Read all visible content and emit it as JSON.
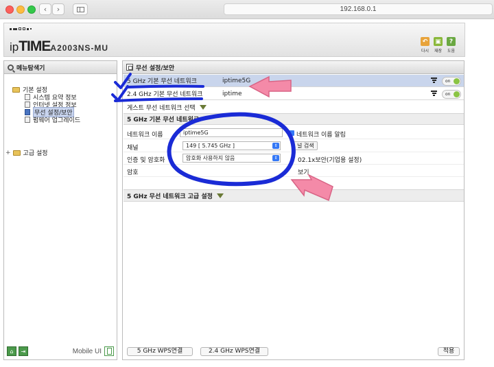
{
  "browser": {
    "url": "192.168.0.1"
  },
  "header": {
    "brand_ip": "ip",
    "brand_time": "TIME",
    "model": "A2003NS-MU",
    "icons": [
      {
        "name": "undo-icon",
        "label": "다시",
        "color": "#e8a33a"
      },
      {
        "name": "save-icon",
        "label": "재장",
        "color": "#8ab83a"
      },
      {
        "name": "help-icon",
        "label": "도움",
        "color": "#6aa842"
      }
    ]
  },
  "sidebar": {
    "title": "메뉴탐색기",
    "basic": "기본 설정",
    "items": [
      "시스템 요약 정보",
      "인터넷 설정 정보",
      "무선 설정/보안",
      "펌웨어 업그레이드"
    ],
    "advanced": "고급 설정",
    "mobile_ui": "Mobile UI"
  },
  "main": {
    "title": "무선 설정/보안",
    "networks": [
      {
        "name": "5 GHz 기본 무선 네트워크",
        "ssid": "iptime5G",
        "toggle": "on"
      },
      {
        "name": "2.4 GHz 기본 무선 네트워크",
        "ssid": "iptime",
        "toggle": "on"
      }
    ],
    "guest": "게스트 무선 네트워크 선택",
    "section": "5 GHz 기본 무선 네트워크",
    "form": {
      "network_name_label": "네트워크 이름",
      "network_name_value": "iptime5G",
      "hide_label": "네트워크 이름 알림",
      "channel_label": "채널",
      "channel_value": "149 [ 5.745 GHz ]",
      "channel_search": "널 검색",
      "auth_label": "인증 및 암호화",
      "auth_value": "암호화 사용하지 않음",
      "auth_extra": "02.1x보안(기업용 설정)",
      "password_label": "암호",
      "password_show": "보기"
    },
    "advanced": "5 GHz 무선 네트워크 고급 설정",
    "buttons": {
      "wps5": "5 GHz WPS연결",
      "wps24": "2.4 GHz WPS연결",
      "apply": "적용"
    }
  },
  "colors": {
    "annotation_blue": "#1a2bd6",
    "annotation_pink": "#f48aa8",
    "toggle_green": "#8ac444",
    "select_blue": "#3478f6"
  }
}
